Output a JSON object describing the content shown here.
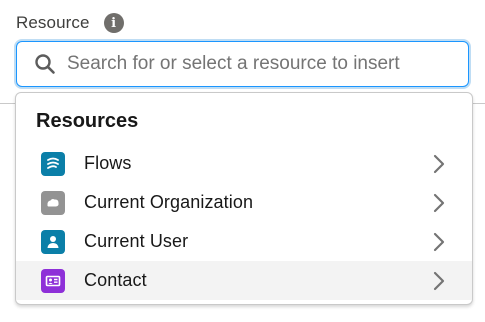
{
  "field": {
    "label": "Resource",
    "info_glyph": "i",
    "search_placeholder": "Search for or select a resource to insert",
    "search_value": ""
  },
  "dropdown": {
    "group_heading": "Resources",
    "items": [
      {
        "label": "Flows",
        "icon": "flow-icon",
        "icon_color": "#0b827c",
        "highlighted": false
      },
      {
        "label": "Current Organization",
        "icon": "organization-icon",
        "icon_color": "#939393",
        "highlighted": false
      },
      {
        "label": "Current User",
        "icon": "user-icon",
        "icon_color": "#0b827c",
        "highlighted": false
      },
      {
        "label": "Contact",
        "icon": "contact-icon",
        "icon_color": "#a094ed",
        "highlighted": true
      }
    ]
  },
  "colors": {
    "focus_border": "#1b96ff",
    "flows_icon": "#0b827c",
    "user_icon": "#1b96ff",
    "contact_icon": "#8e30d8",
    "org_icon": "#939393",
    "highlight_row": "#f3f3f3"
  }
}
